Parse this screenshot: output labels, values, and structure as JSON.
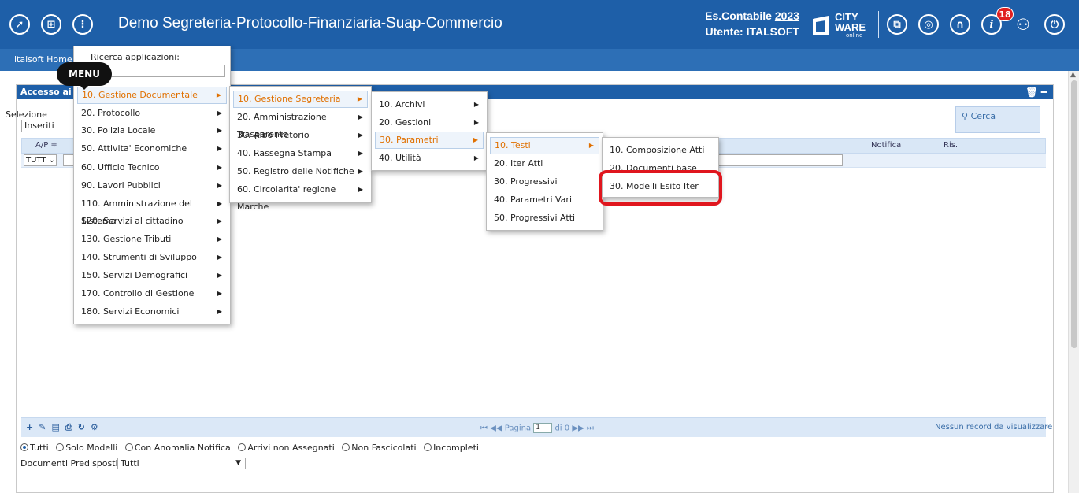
{
  "header": {
    "icons": [
      "rocket-icon",
      "apps-icon",
      "info-circle-icon"
    ],
    "title": "Demo Segreteria-Protocollo-Finanziaria-Suap-Commercio",
    "es_label": "Es.Contabile",
    "es_year": "2023",
    "utente": "Utente: ITALSOFT",
    "logo_line1": "CITY",
    "logo_line2": "WARE",
    "logo_sub": "online",
    "notification_count": "18",
    "right_icons": [
      "windows-icon",
      "help-book-icon",
      "headset-icon",
      "info-icon",
      "user-icon",
      "power-icon"
    ]
  },
  "subbar": {
    "home": "italsoft Home"
  },
  "panel": {
    "title": "Accesso ai p",
    "selezione_label": "Selezione",
    "selezione_value": "Inseriti",
    "cerca_label": "Cerca",
    "columns": {
      "ap": "A/P ≑",
      "notifica": "Notifica",
      "ris": "Ris."
    },
    "tutti_filter": "TUTT ⌄",
    "pager": {
      "pagina": "Pagina",
      "page": "1",
      "of": "di 0"
    },
    "no_records": "Nessun record da visualizzare",
    "radios": [
      {
        "label": "Tutti",
        "checked": true
      },
      {
        "label": "Solo Modelli",
        "checked": false
      },
      {
        "label": "Con Anomalia Notifica",
        "checked": false
      },
      {
        "label": "Arrivi non Assegnati",
        "checked": false
      },
      {
        "label": "Non Fascicolati",
        "checked": false
      },
      {
        "label": "Incompleti",
        "checked": false
      }
    ],
    "predisposti_label": "Documenti Predisposti",
    "predisposti_value": "Tutti"
  },
  "menu": {
    "tip": "MENU",
    "ricerca_label": "Ricerca applicazioni:",
    "level1": [
      "10. Gestione Documentale",
      "20. Protocollo",
      "30. Polizia Locale",
      "50. Attivita' Economiche",
      "60. Ufficio Tecnico",
      "90. Lavori Pubblici",
      "110. Amministrazione del Sistema",
      "120. Servizi al cittadino",
      "130. Gestione Tributi",
      "140. Strumenti di Sviluppo",
      "150. Servizi Demografici",
      "170. Controllo di Gestione",
      "180. Servizi Economici"
    ],
    "level2": [
      "10. Gestione Segreteria",
      "20. Amministrazione Trasparente",
      "30. Albo Pretorio",
      "40. Rassegna Stampa",
      "50. Registro delle Notifiche",
      "60. Circolarita' regione Marche"
    ],
    "level3": [
      "10. Archivi",
      "20. Gestioni",
      "30. Parametri",
      "40. Utilità"
    ],
    "level4": [
      "10. Testi",
      "20. Iter Atti",
      "30. Progressivi",
      "40. Parametri Vari",
      "50. Progressivi Atti"
    ],
    "level5": [
      "10. Composizione Atti",
      "20. Documenti base",
      "30. Modelli Esito Iter"
    ]
  }
}
